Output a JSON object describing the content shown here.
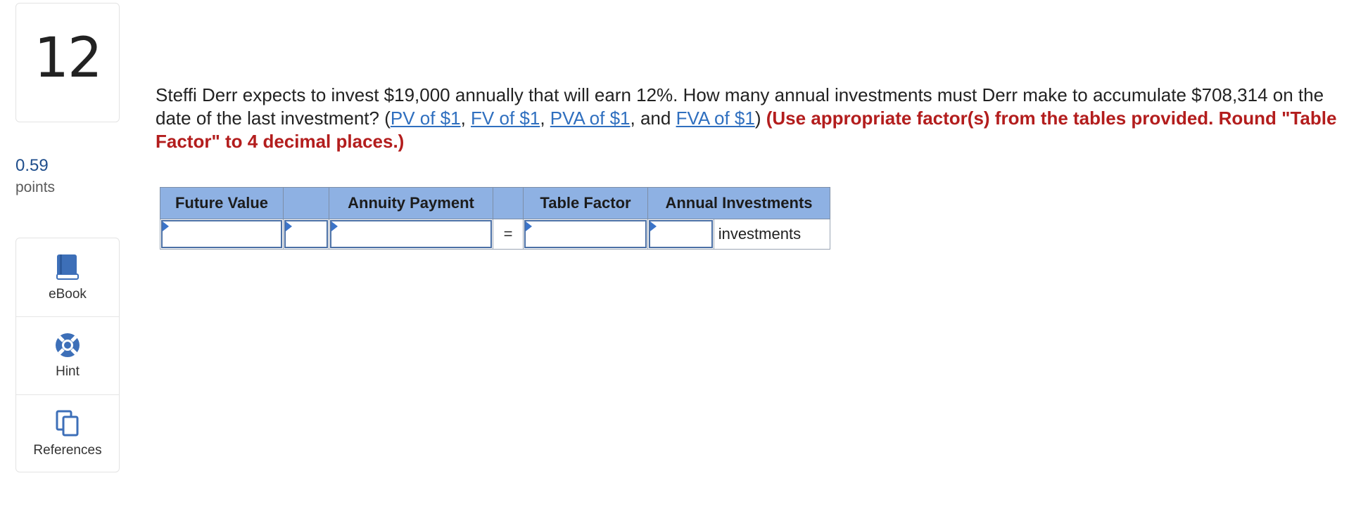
{
  "question": {
    "number": "12",
    "points_value": "0.59",
    "points_label": "points",
    "text_before": "Steffi Derr expects to invest $19,000 annually that will earn 12%. How many annual investments must Derr make to accumulate $708,314 on the date of the last investment? (",
    "links": [
      "PV of $1",
      "FV of $1",
      "PVA of $1",
      "FVA of $1"
    ],
    "sep1": ", ",
    "sep2": ", ",
    "sep3": ", and ",
    "text_after": ")",
    "instruction": "(Use appropriate factor(s) from the tables provided. Round \"Table Factor\" to 4 decimal places.)"
  },
  "tools": {
    "ebook": "eBook",
    "hint": "Hint",
    "references": "References"
  },
  "table": {
    "headers": [
      "Future Value",
      "",
      "Annuity Payment",
      "",
      "Table Factor",
      "Annual Investments"
    ],
    "equals": "=",
    "unit": "investments",
    "inputs": {
      "future_value": "",
      "operator": "",
      "annuity_payment": "",
      "table_factor": "",
      "annual_investments": ""
    }
  },
  "colors": {
    "header_bg": "#8eb1e3",
    "link": "#2f6fbf",
    "instruction": "#b31d1d",
    "points": "#1f4e8c"
  }
}
